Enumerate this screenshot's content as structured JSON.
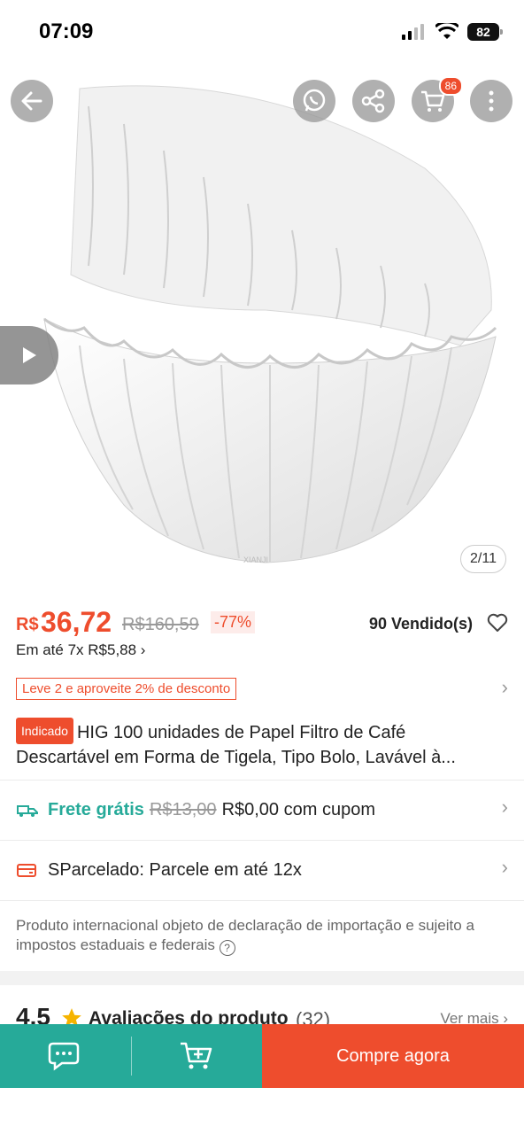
{
  "status_bar": {
    "time": "07:09",
    "battery": "82"
  },
  "gallery": {
    "counter": "2/11",
    "cart_badge": "86",
    "watermark": "XIANJI"
  },
  "price": {
    "currency": "R$",
    "value": "36,72",
    "old": "R$160,59",
    "discount": "-77%",
    "sold": "90 Vendido(s)",
    "installments": "Em até 7x R$5,88 ›"
  },
  "promo": {
    "label": "Leve 2 e aproveite 2% de desconto"
  },
  "product": {
    "badge": "Indicado",
    "title": "HIG 100 unidades de Papel Filtro de Café Descartável em Forma de Tigela, Tipo Bolo, Lavável à..."
  },
  "shipping": {
    "label": "Frete grátis",
    "old": "R$13,00",
    "new": "R$0,00 com cupom"
  },
  "installment_plan": {
    "label": "SParcelado: Parcele em até 12x"
  },
  "import_note": {
    "text": "Produto internacional objeto de declaração de importação e sujeito a impostos estaduais e federais"
  },
  "reviews": {
    "rating": "4.5",
    "title": "Avaliações do produto",
    "count": "(32)",
    "see_more": "Ver mais ›"
  },
  "bottom_bar": {
    "buy_now": "Compre agora"
  },
  "colors": {
    "brand": "#ee4d2d",
    "teal": "#26aa99"
  },
  "icons": [
    "back-arrow-icon",
    "whatsapp-icon",
    "share-icon",
    "cart-icon",
    "more-icon",
    "play-icon",
    "heart-icon",
    "truck-icon",
    "card-icon",
    "help-icon",
    "star-icon",
    "chat-icon",
    "add-to-cart-icon"
  ]
}
